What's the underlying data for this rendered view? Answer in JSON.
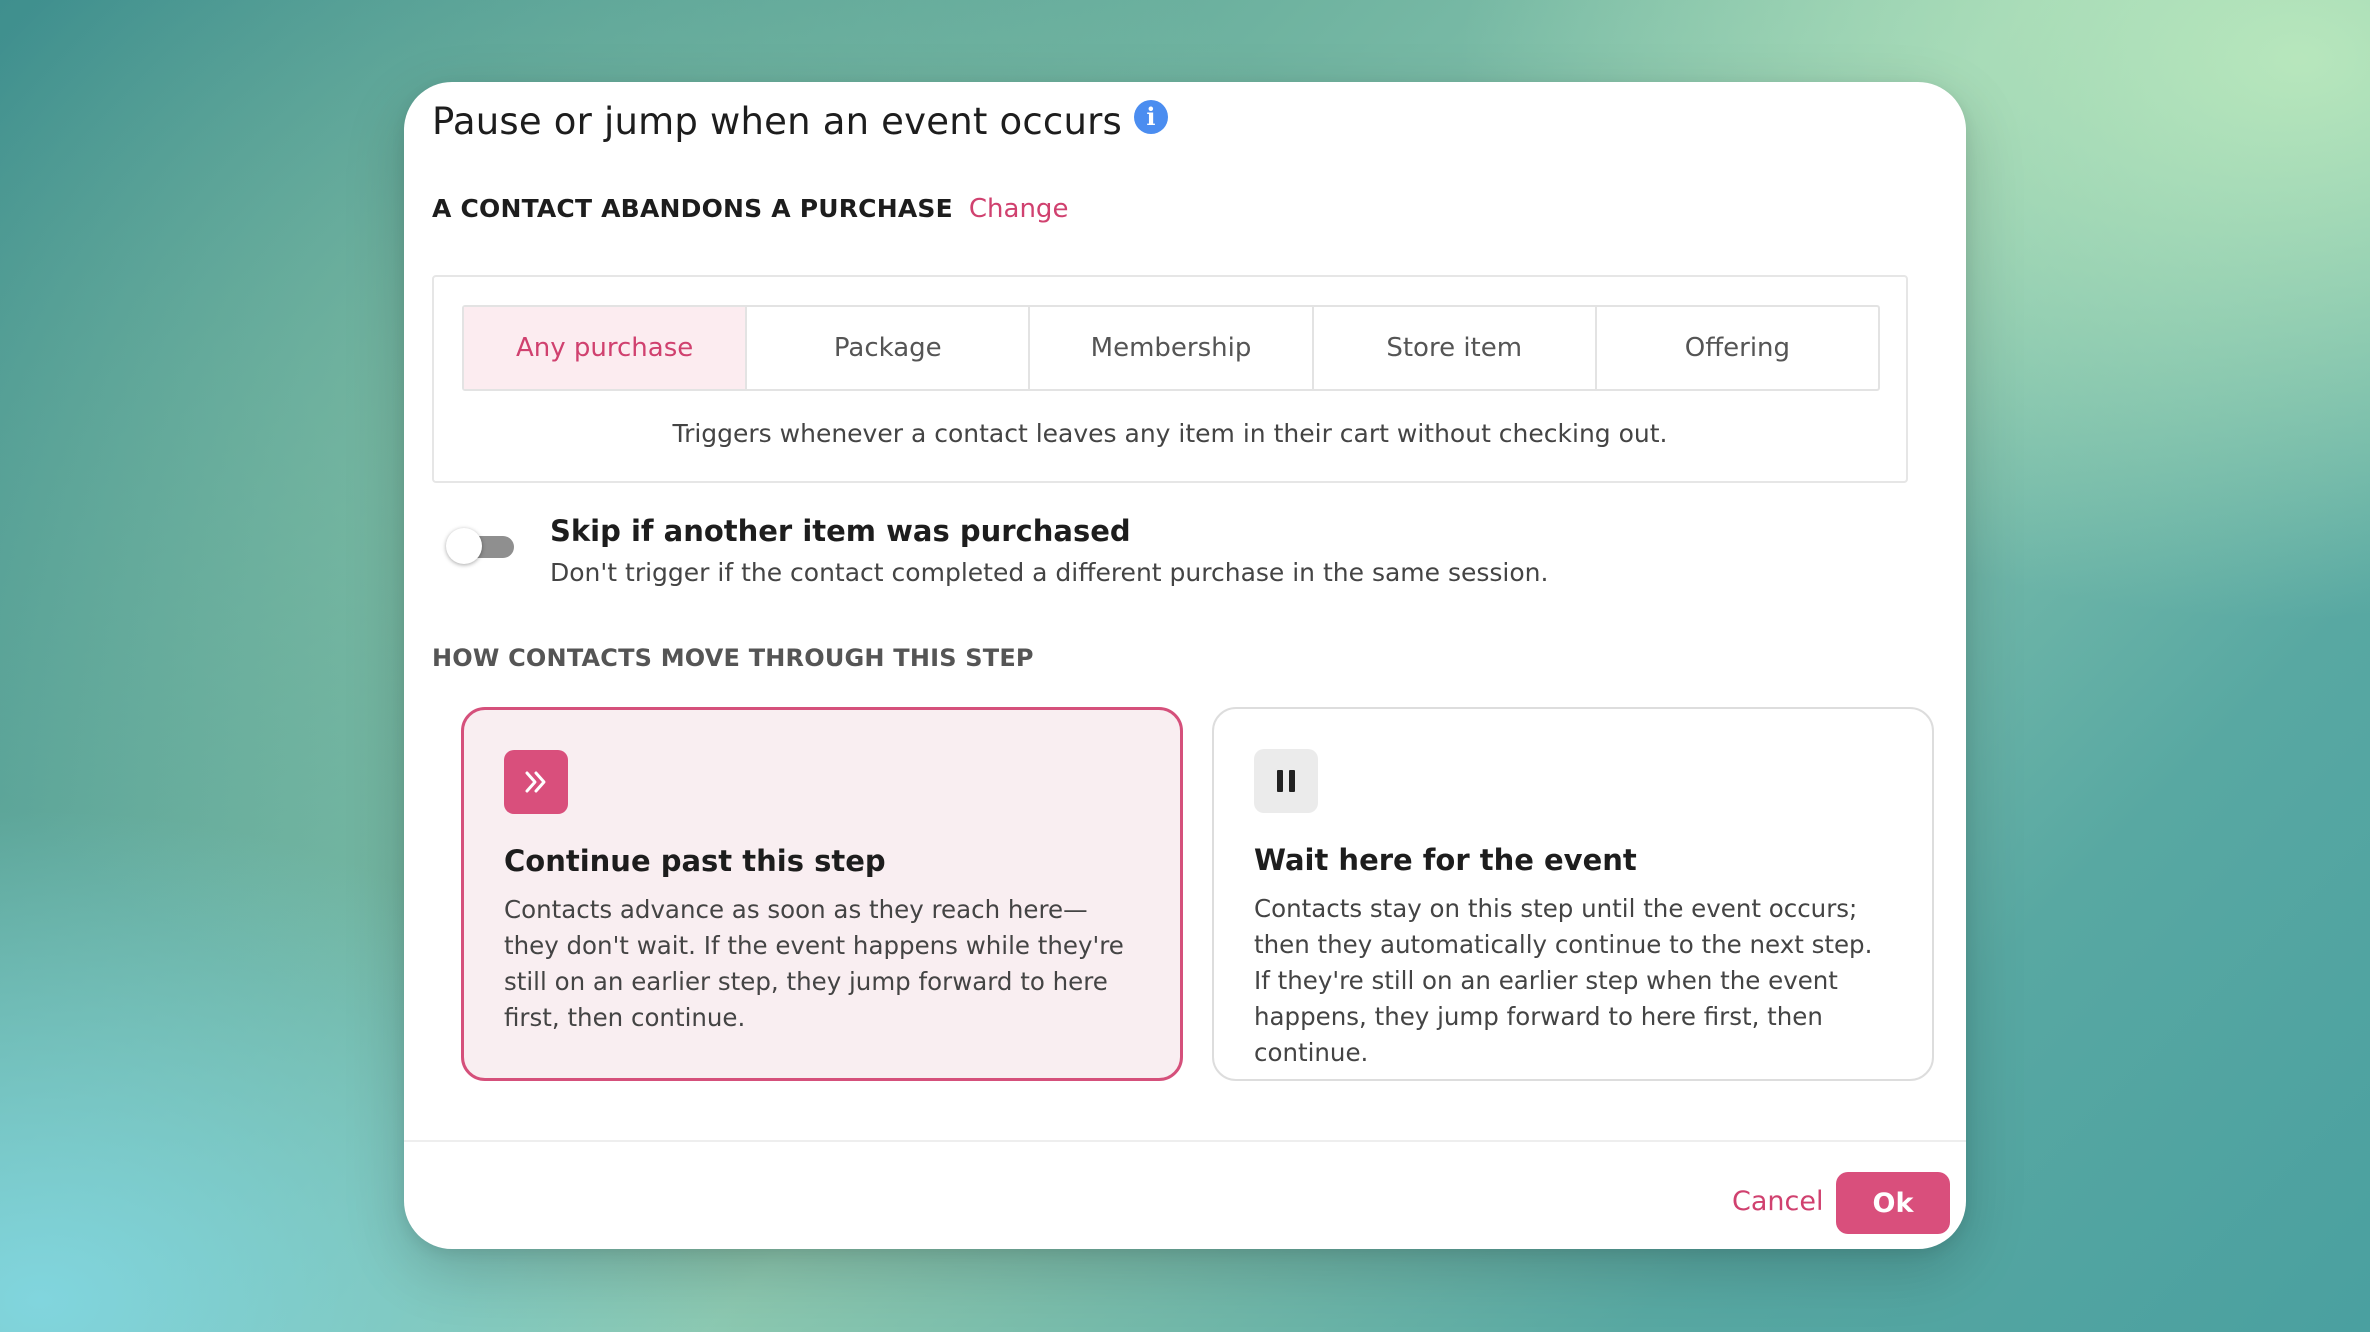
{
  "dialog": {
    "title": "Pause or jump when an event occurs",
    "info_icon": "info-icon",
    "info_glyph": "i"
  },
  "trigger": {
    "label": "A CONTACT ABANDONS A PURCHASE",
    "change_link": "Change"
  },
  "purchase_types": {
    "tabs": [
      {
        "label": "Any purchase",
        "active": true
      },
      {
        "label": "Package",
        "active": false
      },
      {
        "label": "Membership",
        "active": false
      },
      {
        "label": "Store item",
        "active": false
      },
      {
        "label": "Offering",
        "active": false
      }
    ],
    "description": "Triggers whenever a contact leaves any item in their cart without checking out."
  },
  "skip_option": {
    "enabled": false,
    "title": "Skip if another item was purchased",
    "description": "Don't trigger if the contact completed a different purchase in the same session."
  },
  "movement": {
    "section_label": "HOW CONTACTS MOVE THROUGH THIS STEP",
    "options": [
      {
        "icon": "fast-forward-icon",
        "title": "Continue past this step",
        "description": "Contacts advance as soon as they reach here—they don't wait. If the event happens while they're still on an earlier step, they jump forward to here first, then continue.",
        "selected": true
      },
      {
        "icon": "pause-icon",
        "title": "Wait here for the event",
        "description": "Contacts stay on this step until the event occurs; then they automatically continue to the next step. If they're still on an earlier step when the event happens, they jump forward to here first, then continue.",
        "selected": false
      }
    ]
  },
  "footer": {
    "cancel_label": "Cancel",
    "ok_label": "Ok"
  },
  "colors": {
    "accent": "#d94f7c",
    "accent_text": "#d0416f",
    "selected_bg": "#f9eef1",
    "info_blue": "#4b8df0"
  }
}
